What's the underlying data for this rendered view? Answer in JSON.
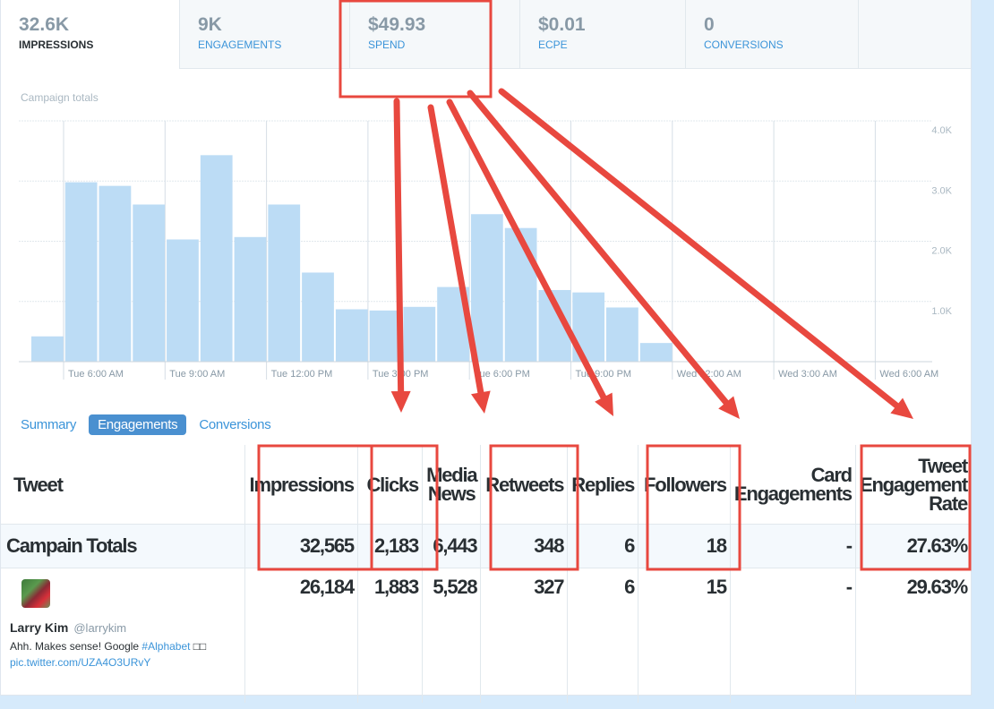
{
  "metric_tabs": [
    {
      "value": "32.6K",
      "label": "IMPRESSIONS",
      "active": true
    },
    {
      "value": "9K",
      "label": "ENGAGEMENTS",
      "active": false
    },
    {
      "value": "$49.93",
      "label": "SPEND",
      "active": false
    },
    {
      "value": "$0.01",
      "label": "ECPE",
      "active": false
    },
    {
      "value": "0",
      "label": "CONVERSIONS",
      "active": false
    },
    {
      "value": "",
      "label": "",
      "active": false
    }
  ],
  "chart_data": {
    "type": "bar",
    "title": "Campaign totals",
    "xlabel": "",
    "ylabel": "",
    "ylim": [
      0,
      4000
    ],
    "yticks": [
      "1.0K",
      "2.0K",
      "3.0K",
      "4.0K"
    ],
    "ytick_values": [
      1000,
      2000,
      3000,
      4000
    ],
    "xticks": [
      "Tue 6:00 AM",
      "Tue 9:00 AM",
      "Tue 12:00 PM",
      "Tue 3:00 PM",
      "Tue 6:00 PM",
      "Tue 9:00 PM",
      "Wed 12:00 AM",
      "Wed 3:00 AM",
      "Wed 6:00 AM"
    ],
    "grid": true,
    "bar_color": "#bcdcf5",
    "categories": [
      "Tue 5AM",
      "Tue 6AM",
      "Tue 7AM",
      "Tue 8AM",
      "Tue 9AM",
      "Tue 10AM",
      "Tue 11AM",
      "Tue 12PM",
      "Tue 1PM",
      "Tue 2PM",
      "Tue 3PM",
      "Tue 4PM",
      "Tue 5PM",
      "Tue 6PM",
      "Tue 7PM",
      "Tue 8PM",
      "Tue 9PM",
      "Tue 10PM",
      "Tue 11PM"
    ],
    "values": [
      420,
      2980,
      2920,
      2610,
      2030,
      3430,
      2070,
      2610,
      1480,
      870,
      850,
      910,
      1240,
      2450,
      2220,
      1190,
      1150,
      900,
      310
    ]
  },
  "subtabs": [
    {
      "label": "Summary",
      "active": false
    },
    {
      "label": "Engagements",
      "active": true
    },
    {
      "label": "Conversions",
      "active": false
    }
  ],
  "table": {
    "headers": [
      "Tweet",
      "Impressions",
      "Clicks",
      "Media News",
      "Retweets",
      "Replies",
      "Followers",
      "Card Engagements",
      "Tweet Engagement Rate"
    ],
    "totals": [
      "Campain Totals",
      "32,565",
      "2,183",
      "6,443",
      "348",
      "6",
      "18",
      "-",
      "27.63%"
    ],
    "rows": [
      {
        "user_name": "Larry Kim",
        "handle": "@larrykim",
        "text": "Ahh. Makes sense! Google ",
        "hashtag": "#Alphabet",
        "emoji": " □□",
        "link": "pic.twitter.com/UZA4O3URvY",
        "values": [
          "26,184",
          "1,883",
          "5,528",
          "327",
          "6",
          "15",
          "-",
          "29.63%"
        ]
      }
    ]
  },
  "annotations": {
    "color": "#e8483f",
    "highlighted": [
      "SPEND",
      "Impressions",
      "Clicks",
      "Retweets",
      "Followers",
      "Tweet Engagement Rate"
    ]
  }
}
